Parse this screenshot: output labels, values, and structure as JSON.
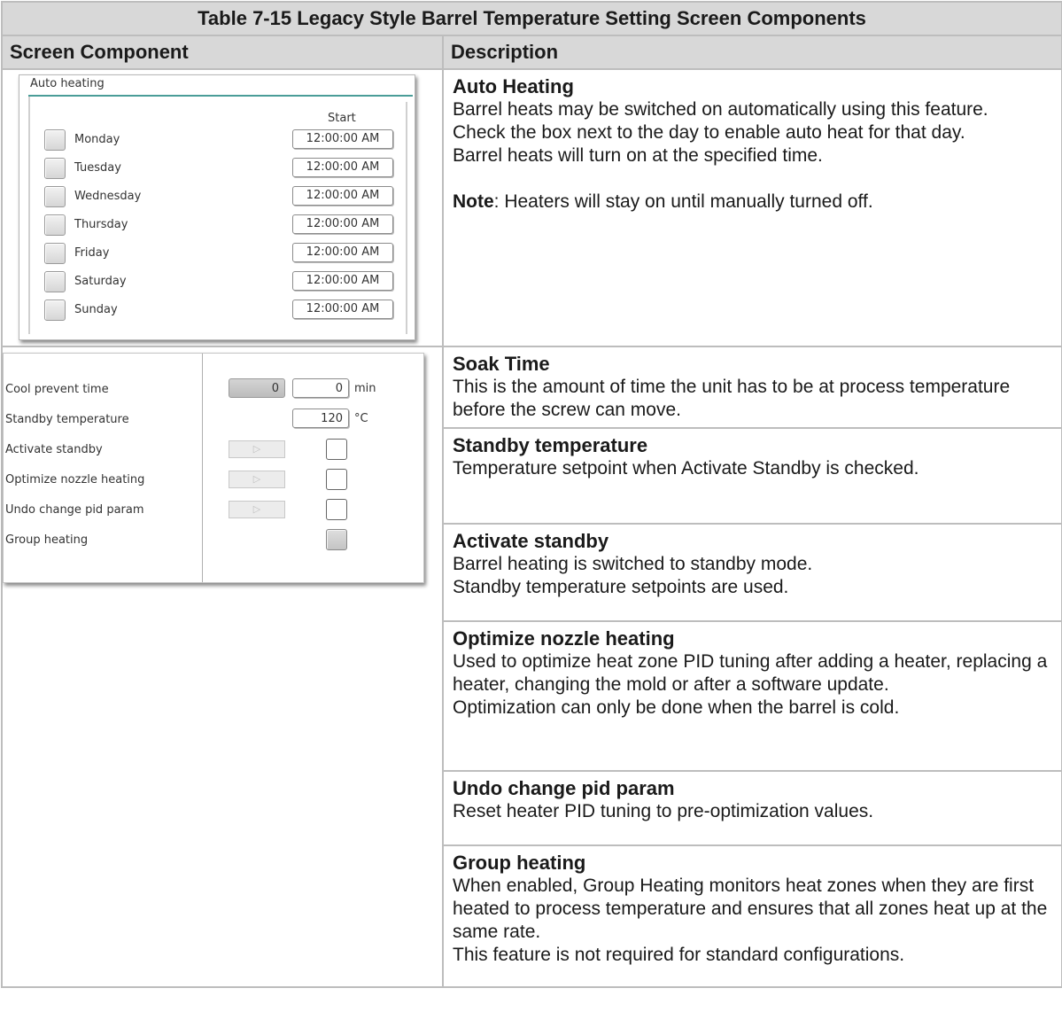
{
  "table_title": "Table 7-15 Legacy Style Barrel Temperature Setting Screen Components",
  "headers": {
    "component": "Screen Component",
    "description": "Description"
  },
  "auto_heating_screen": {
    "panel_title": "Auto heating",
    "start_header": "Start",
    "days": [
      {
        "day": "Monday",
        "time": "12:00:00 AM"
      },
      {
        "day": "Tuesday",
        "time": "12:00:00 AM"
      },
      {
        "day": "Wednesday",
        "time": "12:00:00 AM"
      },
      {
        "day": "Thursday",
        "time": "12:00:00 AM"
      },
      {
        "day": "Friday",
        "time": "12:00:00 AM"
      },
      {
        "day": "Saturday",
        "time": "12:00:00 AM"
      },
      {
        "day": "Sunday",
        "time": "12:00:00 AM"
      }
    ]
  },
  "standby_screen": {
    "labels": [
      "Cool prevent time",
      "Standby temperature",
      "Activate standby",
      "Optimize nozzle heating",
      "Undo change pid param",
      "Group heating"
    ],
    "cool_prevent_actual": "0",
    "cool_prevent_set": "0",
    "cool_prevent_unit": "min",
    "standby_temp": "120",
    "standby_temp_unit": "°C",
    "arrow_glyph": "▷"
  },
  "descriptions": {
    "auto_heating": {
      "title": "Auto Heating",
      "lines": [
        "Barrel heats may be switched on automatically using this feature.",
        "Check the box next to the day to enable auto heat for that day.",
        "Barrel heats will turn on at the specified time."
      ],
      "note_label": "Note",
      "note_text": ": Heaters will stay on until manually turned off."
    },
    "soak_time": {
      "title": "Soak Time",
      "lines": [
        "This is the amount of time the unit has to be at process temperature before the screw can move."
      ]
    },
    "standby_temperature": {
      "title": "Standby temperature",
      "lines": [
        "Temperature setpoint when Activate Standby is checked."
      ]
    },
    "activate_standby": {
      "title": "Activate standby",
      "lines": [
        "Barrel heating is switched to standby mode.",
        "Standby temperature setpoints are used."
      ]
    },
    "optimize_nozzle_heating": {
      "title": "Optimize nozzle heating",
      "lines": [
        "Used to optimize heat zone PID tuning after adding a heater, replacing a heater, changing the mold or after a software update.",
        "Optimization can only be done when the barrel is cold."
      ]
    },
    "undo_change_pid_param": {
      "title": "Undo change pid param",
      "lines": [
        "Reset heater PID tuning to pre-optimization values."
      ]
    },
    "group_heating": {
      "title": "Group heating",
      "lines": [
        "When enabled, Group Heating monitors heat zones when they are first heated to process temperature and ensures that all zones heat up at the same rate.",
        "This feature is not required for standard configurations."
      ]
    }
  }
}
